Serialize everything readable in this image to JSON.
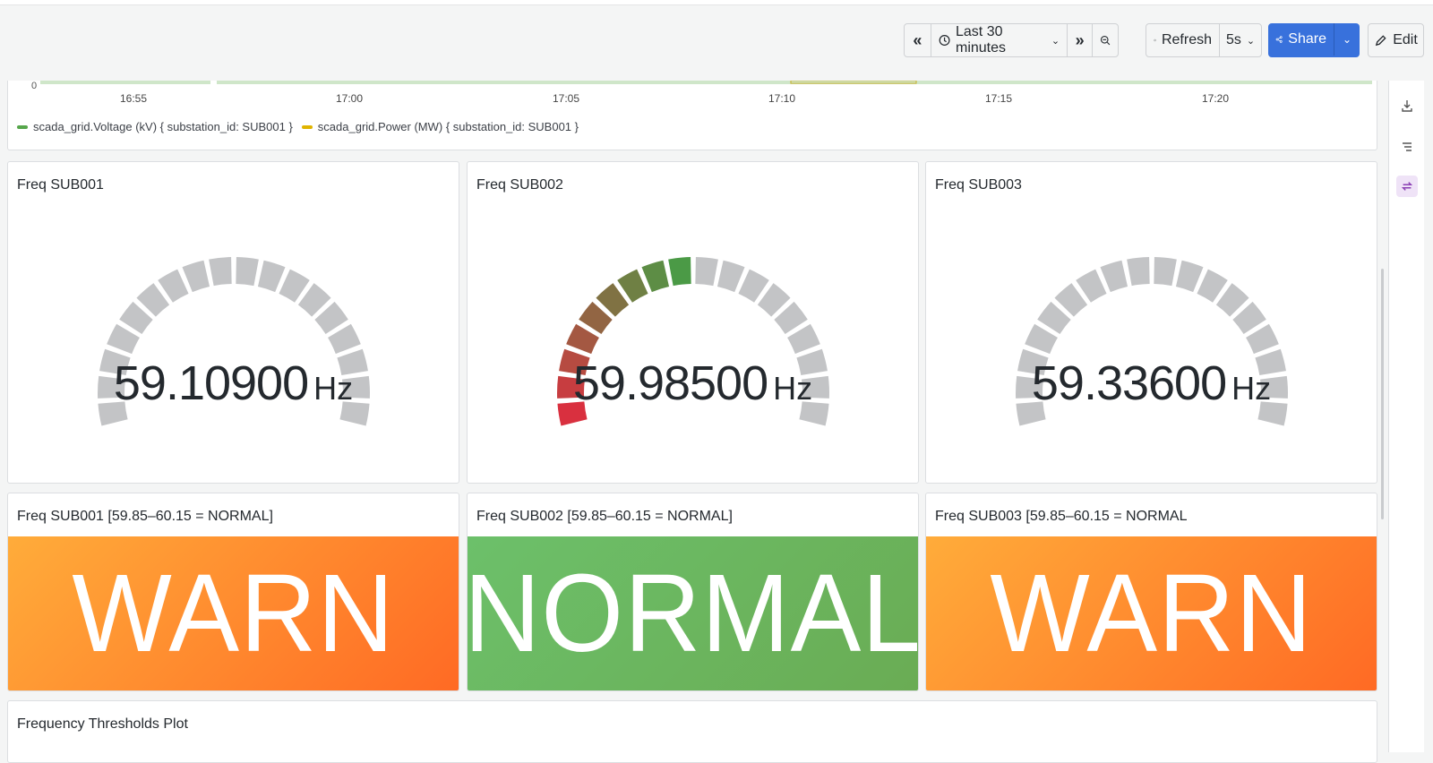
{
  "toolbar": {
    "time_range_label": "Last 30 minutes",
    "refresh_label": "Refresh",
    "refresh_interval": "5s",
    "share_label": "Share",
    "edit_label": "Edit"
  },
  "timeseries": {
    "y_tick": "0",
    "x_ticks": [
      "16:55",
      "17:00",
      "17:05",
      "17:10",
      "17:15",
      "17:20"
    ],
    "legend": [
      {
        "label": "scada_grid.Voltage (kV) { substation_id: SUB001 }",
        "color": "#56a64b"
      },
      {
        "label": "scada_grid.Power (MW) { substation_id: SUB001 }",
        "color": "#e0b400"
      }
    ]
  },
  "gauges": [
    {
      "title": "Freq SUB001",
      "value": "59.10900",
      "unit": "Hz",
      "filled_fraction": 0.0
    },
    {
      "title": "Freq SUB002",
      "value": "59.98500",
      "unit": "Hz",
      "filled_fraction": 0.5
    },
    {
      "title": "Freq SUB003",
      "value": "59.33600",
      "unit": "Hz",
      "filled_fraction": 0.0
    }
  ],
  "stats": [
    {
      "title": "Freq SUB001 [59.85–60.15 = NORMAL]",
      "value": "WARN",
      "color": "#ff7a2e"
    },
    {
      "title": "Freq SUB002 [59.85–60.15 = NORMAL]",
      "value": "NORMAL",
      "color": "#6cbd5f"
    },
    {
      "title": "Freq SUB003 [59.85–60.15 = NORMAL",
      "value": "WARN",
      "color": "#ff7a2e"
    }
  ],
  "bottom_panel": {
    "title": "Frequency Thresholds Plot"
  },
  "colors": {
    "gauge_empty": "#c3c4c6",
    "gauge_red": "#d9303f",
    "gauge_green": "#4b9a46",
    "accent": "#3871dc"
  },
  "icons": [
    "zoom-back-icon",
    "clock-icon",
    "chevron-down-icon",
    "zoom-forward-icon",
    "zoom-out-icon",
    "refresh-icon",
    "share-icon",
    "pencil-icon",
    "download-icon",
    "list-icon",
    "swap-icon"
  ]
}
